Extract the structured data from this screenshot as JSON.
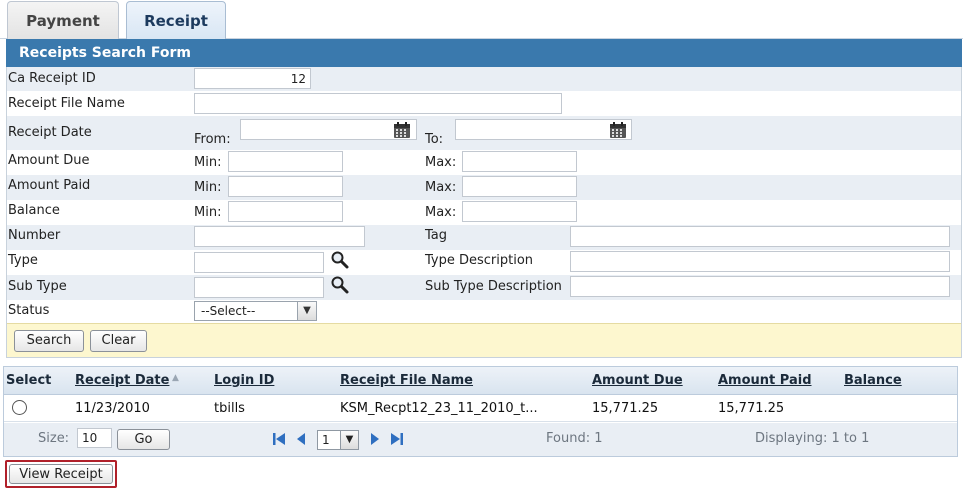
{
  "tabs": [
    {
      "label": "Payment",
      "active": false
    },
    {
      "label": "Receipt",
      "active": true
    }
  ],
  "form": {
    "title": "Receipts Search Form",
    "ca_receipt_id": {
      "label": "Ca Receipt ID",
      "value": "12"
    },
    "receipt_file_name": {
      "label": "Receipt File Name",
      "value": ""
    },
    "receipt_date": {
      "label": "Receipt Date",
      "from_label": "From:",
      "to_label": "To:",
      "from_value": "",
      "to_value": ""
    },
    "amount_due": {
      "label": "Amount Due",
      "min_label": "Min:",
      "max_label": "Max:",
      "min_value": "",
      "max_value": ""
    },
    "amount_paid": {
      "label": "Amount Paid",
      "min_label": "Min:",
      "max_label": "Max:",
      "min_value": "",
      "max_value": ""
    },
    "balance": {
      "label": "Balance",
      "min_label": "Min:",
      "max_label": "Max:",
      "min_value": "",
      "max_value": ""
    },
    "number": {
      "label": "Number",
      "value": ""
    },
    "tag": {
      "label": "Tag",
      "value": ""
    },
    "type": {
      "label": "Type",
      "value": ""
    },
    "type_description": {
      "label": "Type Description",
      "value": ""
    },
    "sub_type": {
      "label": "Sub Type",
      "value": ""
    },
    "sub_type_description": {
      "label": "Sub Type Description",
      "value": ""
    },
    "status": {
      "label": "Status",
      "selected": "--Select--"
    },
    "search_label": "Search",
    "clear_label": "Clear"
  },
  "grid": {
    "columns": [
      "Select",
      "Receipt Date",
      "Login ID",
      "Receipt File Name",
      "Amount Due",
      "Amount Paid",
      "Balance"
    ],
    "rows": [
      {
        "receipt_date": "11/23/2010",
        "login_id": "tbills",
        "file_name": "KSM_Recpt12_23_11_2010_t...",
        "amount_due": "15,771.25",
        "amount_paid": "15,771.25",
        "balance": ""
      }
    ],
    "pager": {
      "size_label": "Size:",
      "size_value": "10",
      "go_label": "Go",
      "page": "1",
      "found": "Found: 1",
      "displaying": "Displaying: 1 to 1"
    }
  },
  "view_receipt_label": "View Receipt",
  "colors": {
    "header_blue": "#3a79ad",
    "highlight_red": "#b0202a",
    "button_bar": "#fdf7cf"
  }
}
